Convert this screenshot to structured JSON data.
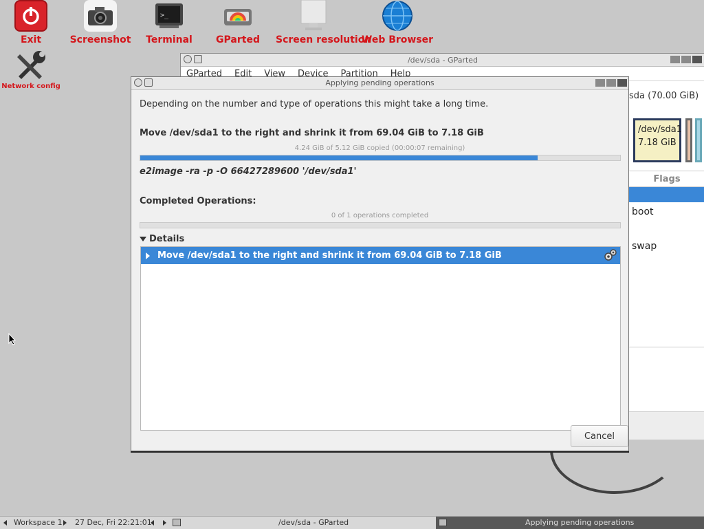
{
  "desktop": {
    "icons": [
      {
        "label": "Exit",
        "icon": "power-icon"
      },
      {
        "label": "Screenshot",
        "icon": "camera-icon"
      },
      {
        "label": "Terminal",
        "icon": "terminal-icon"
      },
      {
        "label": "GParted",
        "icon": "gparted-icon"
      },
      {
        "label": "Screen resolution",
        "icon": "monitor-icon"
      },
      {
        "label": "Web Browser",
        "icon": "globe-icon"
      },
      {
        "label": "Network config",
        "icon": "wrench-icon"
      }
    ]
  },
  "gparted": {
    "title": "/dev/sda - GParted",
    "menu": [
      "GParted",
      "Edit",
      "View",
      "Device",
      "Partition",
      "Help"
    ],
    "device_select": "sda (70.00 GiB)",
    "partition": {
      "name": "/dev/sda1",
      "size": "7.18 GiB"
    },
    "flags_header": "Flags",
    "flags": [
      "boot",
      "swap"
    ]
  },
  "dialog": {
    "title": "Applying pending operations",
    "intro": "Depending on the number and type of operations this might take a long time.",
    "current_operation": "Move /dev/sda1 to the right and shrink it from 69.04 GiB to 7.18 GiB",
    "progress_text": "4.24 GiB of 5.12 GiB copied (00:00:07 remaining)",
    "progress_fraction": 0.828,
    "command": "e2image -ra -p -O 66427289600 '/dev/sda1'",
    "completed_label": "Completed Operations:",
    "completed_text": "0 of 1 operations completed",
    "completed_fraction": 0,
    "details_label": "Details",
    "details_rows": [
      "Move /dev/sda1 to the right and shrink it from 69.04 GiB to 7.18 GiB"
    ],
    "cancel_label": "Cancel"
  },
  "taskbar": {
    "workspace": "Workspace 1",
    "clock": "27 Dec, Fri 22:21:01",
    "task_gparted": "/dev/sda - GParted",
    "task_dialog": "Applying pending operations"
  },
  "colors": {
    "accent": "#3a87d7",
    "desktop_label": "#d4161b",
    "desktop_bg": "#c8c8c8"
  }
}
